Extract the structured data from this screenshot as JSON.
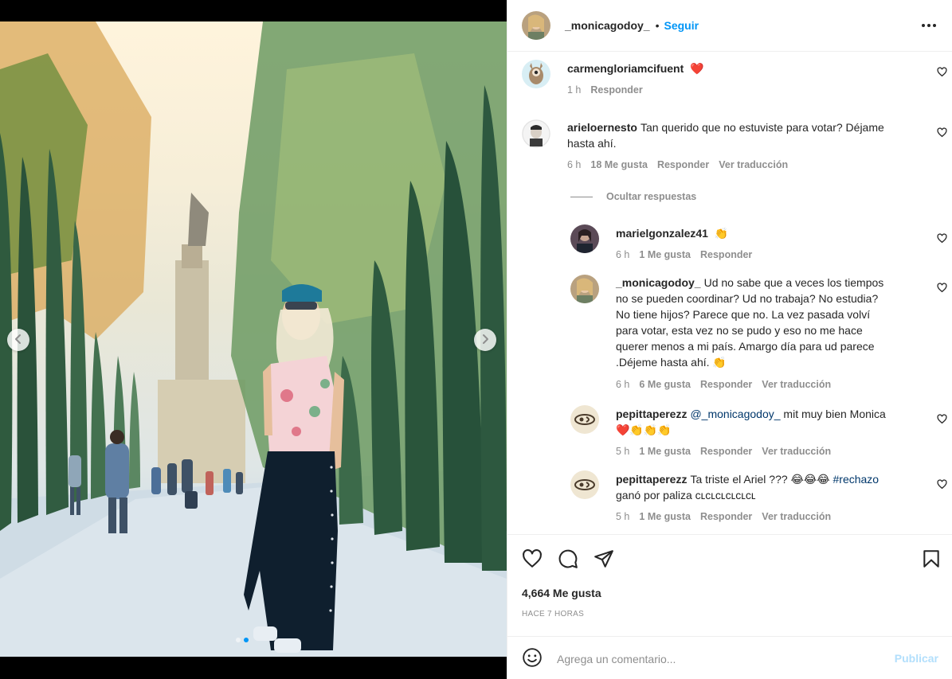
{
  "post": {
    "username": "_monicagodoy_",
    "separator": "•",
    "follow_label": "Seguir",
    "likes_text": "4,664 Me gusta",
    "time_ago": "HACE 7 HORAS",
    "comment_placeholder": "Agrega un comentario...",
    "publish_label": "Publicar",
    "carousel": {
      "slide_count": 2,
      "active_slide": 2
    }
  },
  "comments": [
    {
      "user": "carmengloriamcifuent",
      "text": "❤️",
      "time": "1 h",
      "reply": "Responder"
    },
    {
      "user": "arieloernesto",
      "text_line1": "Tan querido que no estuviste para votar? Déjame",
      "text_line2": "hasta ahí.",
      "time": "6 h",
      "likes": "18 Me gusta",
      "reply": "Responder",
      "translate": "Ver traducción"
    }
  ],
  "hide_replies_label": "Ocultar respuestas",
  "replies": [
    {
      "user": "marielgonzalez41",
      "text": "👏",
      "time": "6 h",
      "likes": "1 Me gusta",
      "reply": "Responder"
    },
    {
      "user": "_monicagodoy_",
      "lines": [
        "Ud no sabe que a veces los tiempos",
        "no se pueden coordinar? Ud no trabaja? No estudia?",
        "No tiene hijos? Parece que no. La vez pasada volví",
        "para votar, esta vez no se pudo y eso no me hace",
        "querer menos a mi país. Amargo día para ud parece",
        ".Déjeme hasta ahí. 👏"
      ],
      "time": "6 h",
      "likes": "6 Me gusta",
      "reply": "Responder",
      "translate": "Ver traducción"
    },
    {
      "user": "pepittaperezz",
      "mention": "@_monicagodoy_",
      "text_after_mention": "mit muy bien Monica",
      "line2": "❤️👏👏👏",
      "time": "5 h",
      "likes": "1 Me gusta",
      "reply": "Responder",
      "translate": "Ver traducción"
    },
    {
      "user": "pepittaperezz",
      "text_before_tag": "Ta triste el Ariel ??? 😂😂😂",
      "hashtag": "#rechazo",
      "line2": "ganó por paliza ᴄʟᴄʟᴄʟᴄʟᴄʟᴄʟ",
      "time": "5 h",
      "likes": "1 Me gusta",
      "reply": "Responder",
      "translate": "Ver traducción"
    }
  ],
  "icons": {
    "more": "more-horizontal-icon",
    "like": "heart-icon",
    "comment": "comment-icon",
    "share": "share-icon",
    "save": "bookmark-icon",
    "emoji": "emoji-icon",
    "prev": "chevron-left-icon",
    "next": "chevron-right-icon"
  },
  "colors": {
    "accent": "#0095f6",
    "publish_disabled": "#b2dffc",
    "meta": "#8e8e8e",
    "text": "#262626"
  }
}
